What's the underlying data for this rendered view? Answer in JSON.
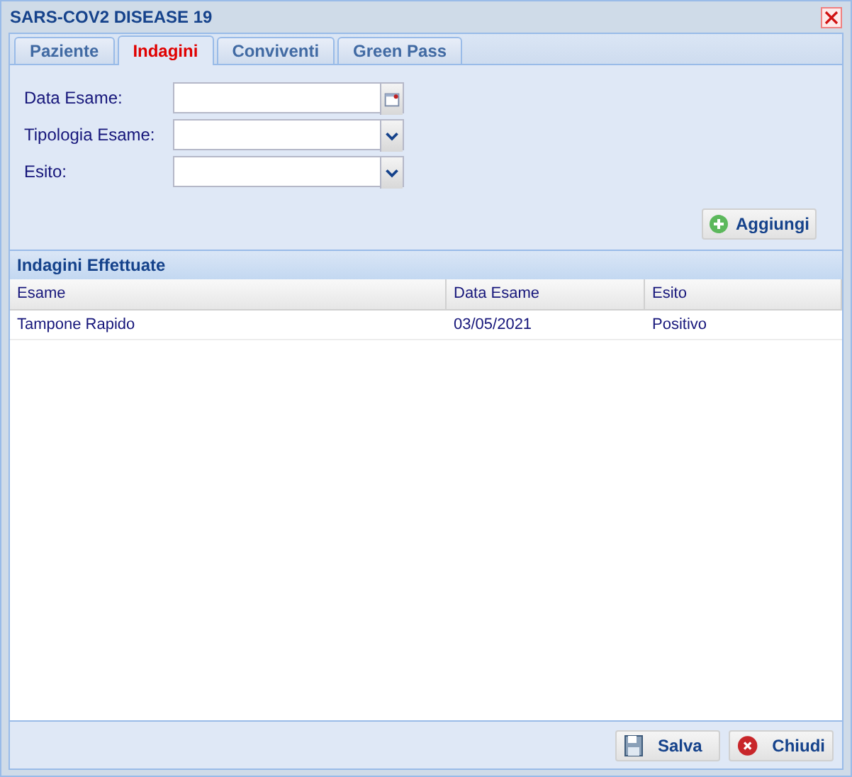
{
  "window": {
    "title": "SARS-COV2 DISEASE 19"
  },
  "tabs": [
    {
      "label": "Paziente",
      "selected": false
    },
    {
      "label": "Indagini",
      "selected": true
    },
    {
      "label": "Conviventi",
      "selected": false
    },
    {
      "label": "Green Pass",
      "selected": false
    }
  ],
  "form": {
    "fields": [
      {
        "label": "Data Esame:",
        "kind": "date"
      },
      {
        "label": "Tipologia Esame:",
        "kind": "combo"
      },
      {
        "label": "Esito:",
        "kind": "combo"
      }
    ],
    "add_button": "Aggiungi"
  },
  "grid": {
    "title": "Indagini Effettuate",
    "columns": [
      "Esame",
      "Data Esame",
      "Esito"
    ],
    "rows": [
      [
        "Tampone Rapido",
        "03/05/2021",
        "Positivo"
      ]
    ]
  },
  "buttons": [
    {
      "label": "Salva",
      "kind": "save"
    },
    {
      "label": "Chiudi",
      "kind": "close"
    }
  ]
}
